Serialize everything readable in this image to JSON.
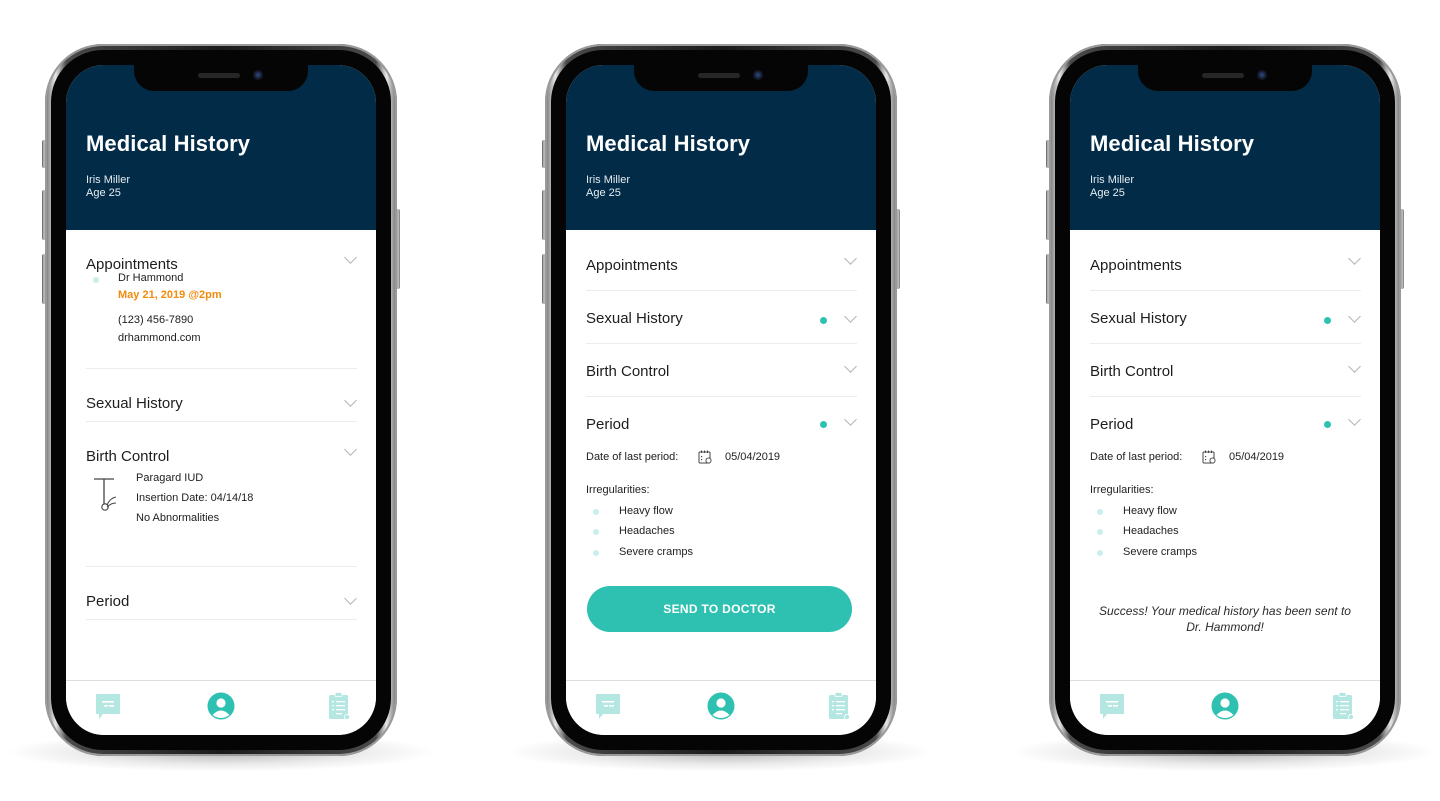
{
  "colors": {
    "header_bg": "#022b47",
    "accent": "#2ec1b1",
    "accent_light": "#b4e6e2",
    "highlight_orange": "#f28a0d"
  },
  "header": {
    "title": "Medical History",
    "patient_name": "Iris Miller",
    "patient_age": "Age 25"
  },
  "screens": [
    {
      "sections": [
        {
          "title": "Appointments",
          "expanded": true,
          "has_status_dot": false,
          "appointment": {
            "doctor": "Dr Hammond",
            "datetime": "May 21, 2019 @2pm",
            "phone": "(123) 456-7890",
            "website": "drhammond.com"
          }
        },
        {
          "title": "Sexual History",
          "expanded": false,
          "has_status_dot": false
        },
        {
          "title": "Birth Control",
          "expanded": true,
          "has_status_dot": false,
          "device": {
            "icon": "iud-icon",
            "name": "Paragard IUD",
            "insertion": "Insertion Date: 04/14/18",
            "notes": "No Abnormalities"
          }
        },
        {
          "title": "Period",
          "expanded": false,
          "has_status_dot": false
        }
      ]
    },
    {
      "sections": [
        {
          "title": "Appointments",
          "expanded": false,
          "has_status_dot": false
        },
        {
          "title": "Sexual History",
          "expanded": false,
          "has_status_dot": true
        },
        {
          "title": "Birth Control",
          "expanded": false,
          "has_status_dot": false
        },
        {
          "title": "Period",
          "expanded": true,
          "has_status_dot": true,
          "last_period_label": "Date of last period:",
          "last_period_date": "05/04/2019",
          "irregularities_label": "Irregularities:",
          "irregularities": [
            "Heavy flow",
            "Headaches",
            "Severe cramps"
          ]
        }
      ],
      "send_button": "SEND TO DOCTOR"
    },
    {
      "sections": [
        {
          "title": "Appointments",
          "expanded": false,
          "has_status_dot": false
        },
        {
          "title": "Sexual History",
          "expanded": false,
          "has_status_dot": true
        },
        {
          "title": "Birth Control",
          "expanded": false,
          "has_status_dot": false
        },
        {
          "title": "Period",
          "expanded": true,
          "has_status_dot": true,
          "last_period_label": "Date of last period:",
          "last_period_date": "05/04/2019",
          "irregularities_label": "Irregularities:",
          "irregularities": [
            "Heavy flow",
            "Headaches",
            "Severe cramps"
          ]
        }
      ],
      "success_message": "Success! Your medical history has been sent to Dr. Hammond!"
    }
  ],
  "tabbar": [
    {
      "name": "messages",
      "icon": "chat-icon",
      "active": false
    },
    {
      "name": "profile",
      "icon": "profile-icon",
      "active": true
    },
    {
      "name": "records",
      "icon": "clipboard-icon",
      "active": false
    }
  ]
}
